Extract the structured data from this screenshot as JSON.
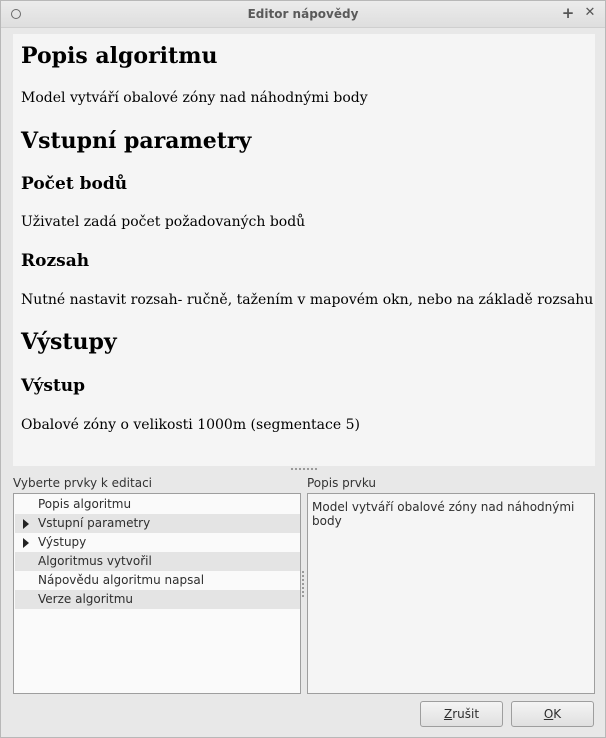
{
  "window": {
    "title": "Editor nápovědy",
    "maximize_glyph": "+",
    "close_glyph": "✕"
  },
  "preview": {
    "h1_description": "Popis algoritmu",
    "p_description": "Model vytváří obalové zóny nad náhodnými body",
    "h1_inputs": "Vstupní parametry",
    "h2_count": "Počet bodů",
    "p_count": "Uživatel zadá počet požadovaných bodů",
    "h2_extent": "Rozsah",
    "p_extent": "Nutné nastavit rozsah- ručně, tažením v mapovém okn, nebo na základě rozsahu vrstvy",
    "h1_outputs": "Výstupy",
    "h2_output": "Výstup",
    "p_output": "Obalové zóny o velikosti 1000m (segmentace 5)"
  },
  "tree": {
    "label": "Vyberte prvky k editaci",
    "items": [
      {
        "label": "Popis algoritmu",
        "expandable": false
      },
      {
        "label": "Vstupní parametry",
        "expandable": true
      },
      {
        "label": "Výstupy",
        "expandable": true
      },
      {
        "label": "Algoritmus vytvořil",
        "expandable": false
      },
      {
        "label": "Nápovědu algoritmu napsal",
        "expandable": false
      },
      {
        "label": "Verze algoritmu",
        "expandable": false
      }
    ]
  },
  "description": {
    "label": "Popis prvku",
    "value": "Model vytváří obalové zóny nad náhodnými body"
  },
  "buttons": {
    "cancel_mnemonic": "Z",
    "cancel_rest": "rušit",
    "ok_mnemonic": "O",
    "ok_rest": "K"
  }
}
